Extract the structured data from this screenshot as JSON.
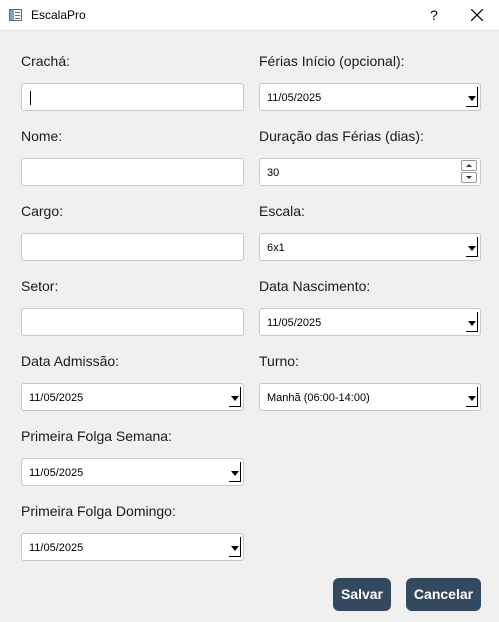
{
  "window": {
    "title": "EscalaPro",
    "help": "?"
  },
  "left": {
    "cracha_label": "Crachá:",
    "cracha_value": "",
    "nome_label": "Nome:",
    "nome_value": "",
    "cargo_label": "Cargo:",
    "cargo_value": "",
    "setor_label": "Setor:",
    "setor_value": "",
    "admissao_label": "Data Admissão:",
    "admissao_value": "11/05/2025",
    "folga_semana_label": "Primeira Folga Semana:",
    "folga_semana_value": "11/05/2025",
    "folga_domingo_label": "Primeira Folga Domingo:",
    "folga_domingo_value": "11/05/2025"
  },
  "right": {
    "ferias_inicio_label": "Férias Início (opcional):",
    "ferias_inicio_value": "11/05/2025",
    "duracao_label": "Duração das Férias (dias):",
    "duracao_value": "30",
    "escala_label": "Escala:",
    "escala_value": "6x1",
    "nascimento_label": "Data Nascimento:",
    "nascimento_value": "11/05/2025",
    "turno_label": "Turno:",
    "turno_value": "Manhã (06:00-14:00)"
  },
  "buttons": {
    "save": "Salvar",
    "cancel": "Cancelar"
  },
  "colors": {
    "button_bg": "#34495e",
    "window_bg": "#f0f0f0"
  },
  "icons": {
    "app": "app-window-icon",
    "close": "close-icon",
    "help": "help-icon"
  }
}
